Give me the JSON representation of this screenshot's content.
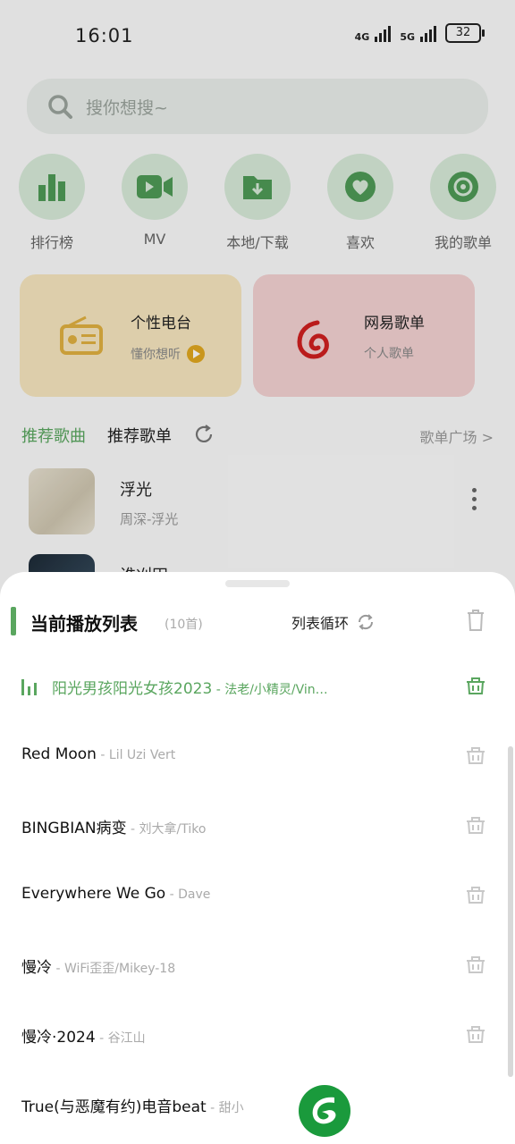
{
  "status_bar": {
    "time": "16:01",
    "signal_1": "4G",
    "signal_2": "5G",
    "battery": "32"
  },
  "search": {
    "placeholder": "搜你想搜~"
  },
  "quick_links": [
    {
      "label": "排行榜",
      "icon": "chart-bars-icon"
    },
    {
      "label": "MV",
      "icon": "video-icon"
    },
    {
      "label": "本地/下载",
      "icon": "download-folder-icon"
    },
    {
      "label": "喜欢",
      "icon": "heart-icon"
    },
    {
      "label": "我的歌单",
      "icon": "disc-icon"
    }
  ],
  "cards": {
    "radio": {
      "title": "个性电台",
      "subtitle": "懂你想听"
    },
    "netease": {
      "title": "网易歌单",
      "subtitle": "个人歌单"
    }
  },
  "tabs": {
    "recommended_songs": "推荐歌曲",
    "recommended_playlists": "推荐歌单",
    "plaza": "歌单广场 >"
  },
  "songs": [
    {
      "title": "浮光",
      "subtitle": "周深-浮光"
    },
    {
      "title": "谁刈田",
      "subtitle": ""
    }
  ],
  "playlist": {
    "title": "当前播放列表",
    "count": "(10首)",
    "mode": "列表循环",
    "items": [
      {
        "title": "阳光男孩阳光女孩2023",
        "artist": " - 法老/小精灵/Vin…",
        "active": true
      },
      {
        "title": "Red Moon",
        "artist": " - Lil Uzi Vert"
      },
      {
        "title": "BINGBIAN病变",
        "artist": " - 刘大拿/Tiko"
      },
      {
        "title": "Everywhere We Go",
        "artist": " - Dave"
      },
      {
        "title": "慢冷",
        "artist": " - WiFi歪歪/Mikey-18"
      },
      {
        "title": "慢冷·2024",
        "artist": " - 谷江山"
      },
      {
        "title": "True(与恶魔有约)电音beat",
        "artist": " - 甜小"
      }
    ]
  },
  "colors": {
    "accent": "#5aa65f",
    "sheet_bg": "#ffffff",
    "radio_card": "#f6e6bf",
    "netease_card": "#f3d2d2"
  }
}
